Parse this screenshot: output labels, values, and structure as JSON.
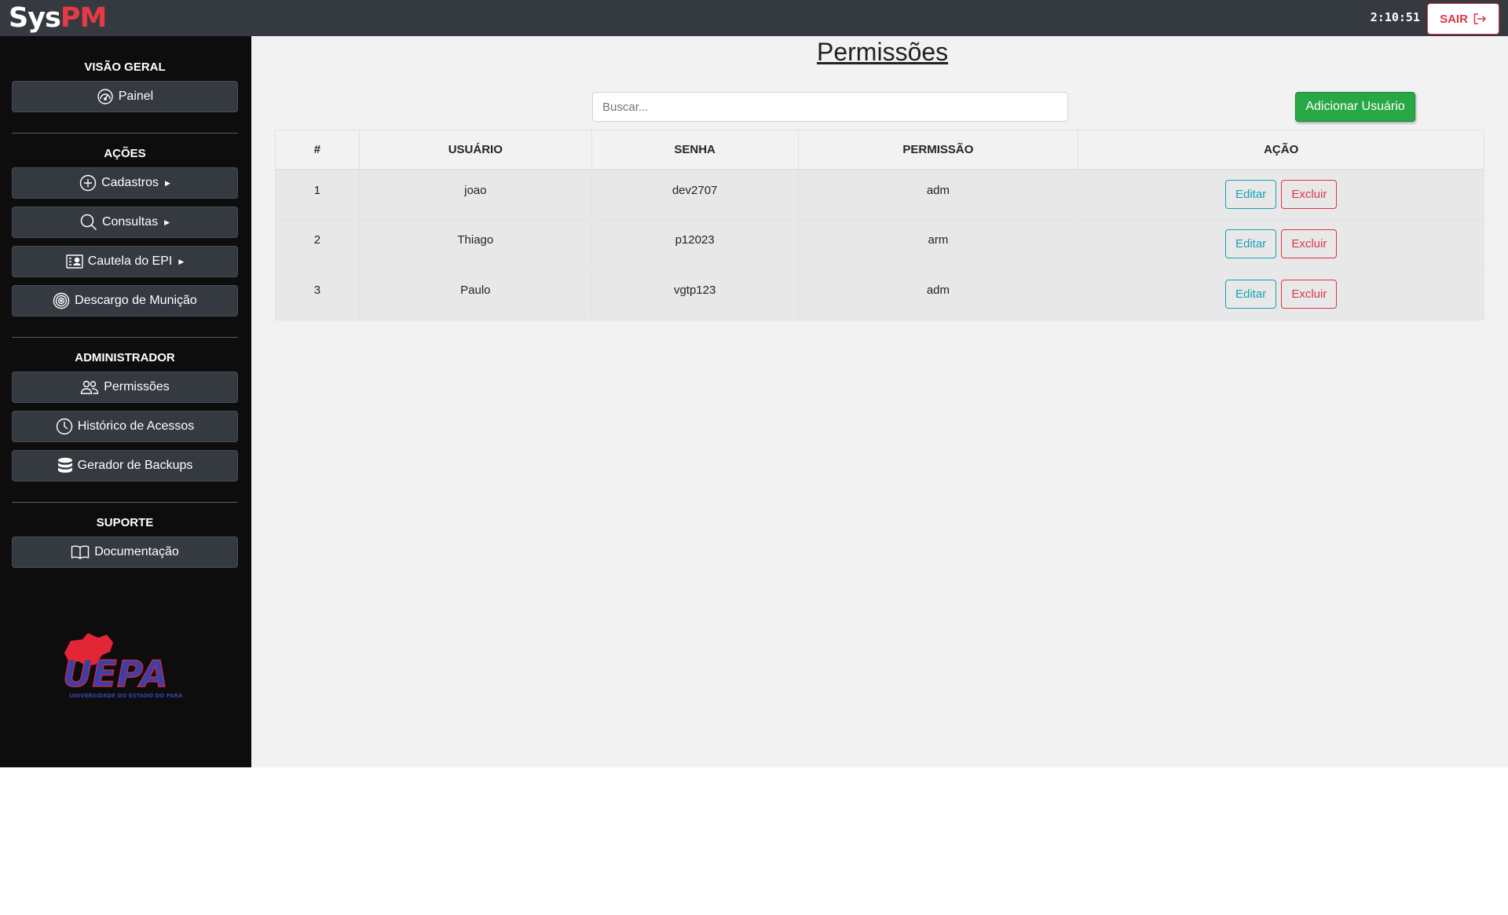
{
  "header": {
    "logo_sys": "Sys",
    "logo_pm": "PM",
    "clock": "2:10:51",
    "logout_label": "SAIR"
  },
  "sidebar": {
    "sections": [
      {
        "title": "VISÃO GERAL",
        "items": [
          {
            "label": "Painel",
            "icon": "dashboard-icon"
          }
        ]
      },
      {
        "title": "AÇÕES",
        "items": [
          {
            "label": "Cadastros",
            "icon": "plus-circle-icon"
          },
          {
            "label": "Consultas",
            "icon": "search-icon"
          },
          {
            "label": "Cautela do EPI",
            "icon": "id-card-icon"
          },
          {
            "label": "Descargo de Munição",
            "icon": "target-icon"
          }
        ]
      },
      {
        "title": "ADMINISTRADOR",
        "items": [
          {
            "label": "Permissões",
            "icon": "users-icon"
          },
          {
            "label": "Histórico de Acessos",
            "icon": "clock-icon"
          },
          {
            "label": "Gerador de Backups",
            "icon": "database-icon"
          }
        ]
      },
      {
        "title": "SUPORTE",
        "items": [
          {
            "label": "Documentação",
            "icon": "book-icon"
          }
        ]
      }
    ],
    "logo_text": "UEPA",
    "logo_subtext": "UNIVERSIDADE DO ESTADO DO PARÁ"
  },
  "main": {
    "title": "Permissões",
    "search_placeholder": "Buscar...",
    "add_button": "Adicionar Usuário",
    "table": {
      "headers": [
        "#",
        "USUÁRIO",
        "SENHA",
        "PERMISSÃO",
        "AÇÃO"
      ],
      "rows": [
        {
          "id": "1",
          "user": "joao",
          "password": "dev2707",
          "permission": "adm"
        },
        {
          "id": "2",
          "user": "Thiago",
          "password": "p12023",
          "permission": "arm"
        },
        {
          "id": "3",
          "user": "Paulo",
          "password": "vgtp123",
          "permission": "adm"
        }
      ],
      "edit_label": "Editar",
      "delete_label": "Excluir"
    }
  },
  "colors": {
    "topbar": "#343a40",
    "sidebar": "#0d0d0d",
    "brand_red": "#e63946",
    "success": "#28a745",
    "info": "#17a2b8",
    "danger": "#dc3545"
  }
}
